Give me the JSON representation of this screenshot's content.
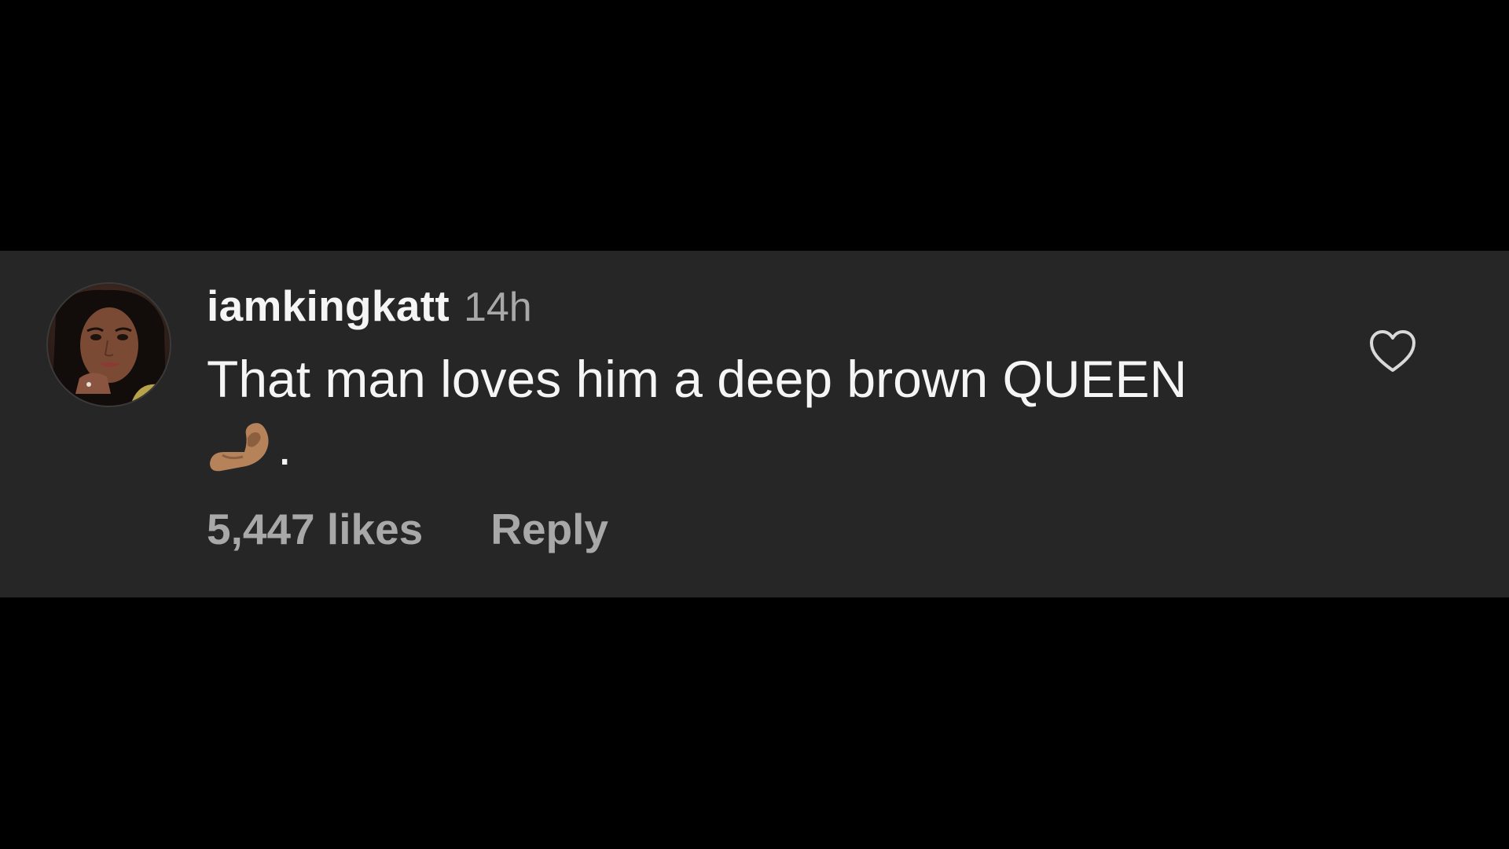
{
  "comment": {
    "username": "iamkingkatt",
    "timestamp": "14h",
    "text": "That man loves him a deep brown QUEEN",
    "text_tail": ".",
    "emoji_icon": "pinched-fingers-icon",
    "likes_label": "5,447 likes",
    "reply_label": "Reply",
    "like_icon": "heart-outline-icon"
  },
  "colors": {
    "background": "#000000",
    "card": "#262626",
    "primary_text": "#f5f5f5",
    "secondary_text": "#a8a8a8"
  }
}
